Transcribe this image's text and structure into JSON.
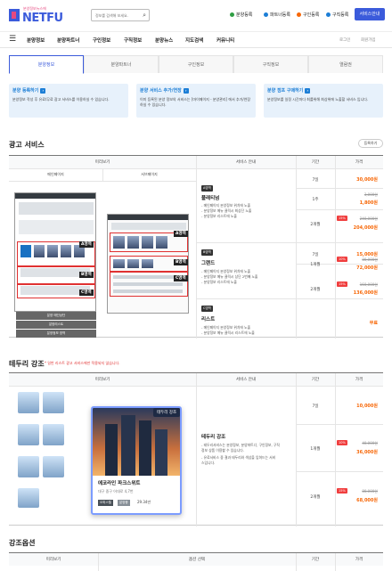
{
  "header": {
    "logo_sub": "분양정보뉴스에",
    "logo_main": "NETFU",
    "search_placeholder": "정보를 검색해 보세요.",
    "links": [
      {
        "label": "분양등록",
        "color": "#2f9e44"
      },
      {
        "label": "파트너등록",
        "color": "#1c7ed6"
      },
      {
        "label": "구인등록",
        "color": "#f76707"
      },
      {
        "label": "구직등록",
        "color": "#1c7ed6"
      }
    ],
    "cta": "서비스안내"
  },
  "nav": {
    "items": [
      "분양정보",
      "분양파트너",
      "구인정보",
      "구직정보",
      "분양뉴스",
      "지도검색",
      "커뮤니티"
    ],
    "login": "로그인",
    "signup": "회원가입"
  },
  "tabs": [
    "분양정보",
    "분양파트너",
    "구인정보",
    "구직정보",
    "열람권"
  ],
  "cards": [
    {
      "title": "분양 등록하기",
      "desc": "분양정보 작성 후 유료/무료 광고 서비스를 이용하실 수 있습니다."
    },
    {
      "title": "분양 서비스 추가/연장",
      "desc": "이미 등록된 분양 정보의 서비스는 [마이페이지 - 분양관리] 에서 추가/연장하실 수 있습니다."
    },
    {
      "title": "분양 점프 구매하기",
      "desc": "분양정보를 일정 시간마다 최를위해 최상위에 노출할 서비스 입니다."
    }
  ],
  "ad": {
    "title": "광고 서비스",
    "btn": "등록하기",
    "headers": [
      "미리보기",
      "서비스 안내",
      "기간",
      "가격"
    ],
    "sub_headers": [
      "메인페이지",
      "서브페이지"
    ],
    "areas": [
      "분양 메인상단",
      "분양리스트",
      "분양정보 영역"
    ],
    "rows": [
      {
        "tag": "A영역",
        "name": "플래티넘",
        "desc": [
          "- 메인페이지 분양정보 위치에 노출",
          "- 분양정보 메뉴 클릭시 최상단 노출",
          "- 분양정보 리스트에 노출"
        ]
      },
      {
        "tag": "B영역",
        "name": "그랜드",
        "desc": [
          "- 메인페이지 분양정보 위치에 노출",
          "- 분양정보 메뉴 클릭시 상단 2번째 노출",
          "- 분양정보 리스트에 노출"
        ]
      },
      {
        "tag": "C영역",
        "name": "리스트",
        "desc": [
          "- 메인페이지 분양정보 위치에 노출",
          "- 분양정보 메뉴 클릭시 리스트에 노출"
        ]
      }
    ],
    "prices": [
      {
        "period": "7일",
        "price": "30,000원"
      },
      {
        "period": "1주",
        "orig": "3,000원",
        "pct": "",
        "price": "1,800원"
      },
      {
        "period": "2개월",
        "orig": "240,000원",
        "pct": "15%",
        "price": "204,000원"
      },
      {
        "period": "7일",
        "price": "15,000원"
      },
      {
        "period": "1개월",
        "orig": "80,000원",
        "pct": "10%",
        "price": "72,000원"
      },
      {
        "period": "2개월",
        "orig": "160,000원",
        "pct": "15%",
        "price": "136,000원"
      },
      {
        "period": "",
        "price": "무료"
      }
    ],
    "zone_labels": [
      "A영역",
      "B영역",
      "C영역"
    ]
  },
  "hl": {
    "title": "테두리 강조",
    "note": "* 일반 리스트 광고 서비스에만 적용되지 않습니다.",
    "headers": [
      "미리보기",
      "서비스 안내",
      "기간",
      "가격"
    ],
    "badge": "테두리 강조",
    "name": "테두리 강조",
    "desc": [
      "- 테두리서비스는 분양정보, 분양파트너, 구인정보, 구직",
      "  정보 상품 이용할 수 있습니다.",
      "- 유료서비스 중 결과 테두리와 색상을 입혀드는 서비",
      "  스입니다."
    ],
    "building_title": "에코라인 파크스위트",
    "building_addr": "대구 중구 어대로 4,7번",
    "building_tags": [
      "오피스텔",
      "분양중"
    ],
    "building_price": "29.34만",
    "prices": [
      {
        "period": "7일",
        "price": "10,000원"
      },
      {
        "period": "1개월",
        "orig": "40,000원",
        "pct": "10%",
        "price": "36,000원"
      },
      {
        "period": "2개월",
        "orig": "80,000원",
        "pct": "15%",
        "price": "68,000원"
      }
    ]
  },
  "opt": {
    "title": "강조옵션",
    "headers": [
      "미리보기",
      "옵션 선택",
      "기간",
      "가격"
    ]
  }
}
